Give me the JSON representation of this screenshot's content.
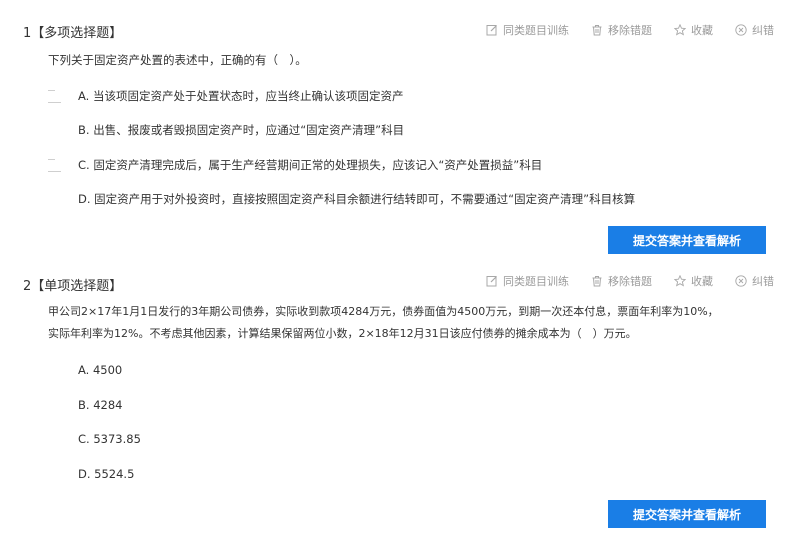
{
  "tools": {
    "train": "同类题目训练",
    "remove": "移除错题",
    "favorite": "收藏",
    "report": "纠错"
  },
  "q1": {
    "header": "1【多项选择题】",
    "stem": "下列关于固定资产处置的表述中，正确的有（　）。",
    "options": [
      "A. 当该项固定资产处于处置状态时，应当终止确认该项固定资产",
      "B. 出售、报废或者毁损固定资产时，应通过“固定资产清理”科目",
      "C. 固定资产清理完成后，属于生产经营期间正常的处理损失，应该记入“资产处置损益”科目",
      "D. 固定资产用于对外投资时，直接按照固定资产科目余额进行结转即可，不需要通过“固定资产清理”科目核算"
    ],
    "submit": "提交答案并查看解析"
  },
  "q2": {
    "header": "2【单项选择题】",
    "stem_line1": "甲公司2×17年1月1日发行的3年期公司债券，实际收到款项4284万元，债券面值为4500万元，到期一次还本付息，票面年利率为10%，",
    "stem_line2": "实际年利率为12%。不考虑其他因素，计算结果保留两位小数，2×18年12月31日该应付债券的摊余成本为（　）万元。",
    "options": [
      "A. 4500",
      "B. 4284",
      "C. 5373.85",
      "D. 5524.5"
    ],
    "submit": "提交答案并查看解析"
  }
}
